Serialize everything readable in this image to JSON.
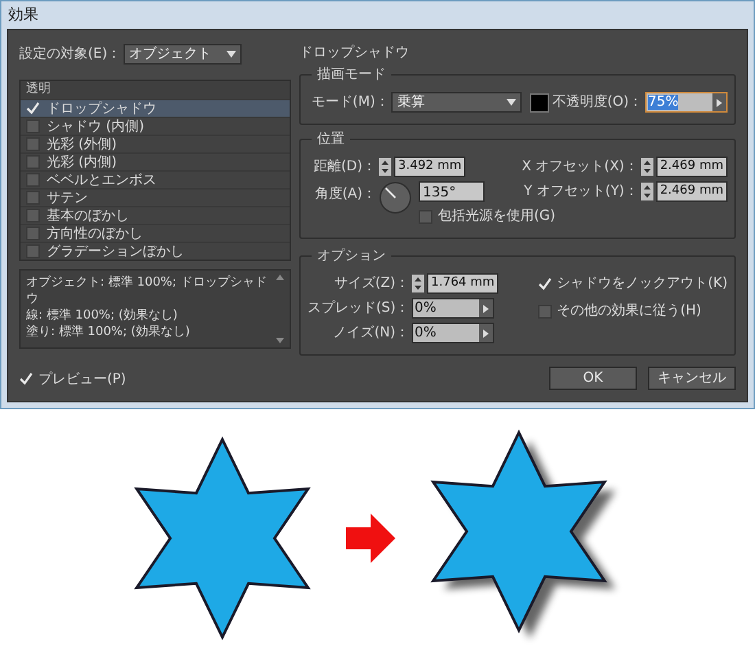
{
  "window": {
    "title": "効果"
  },
  "target": {
    "label": "設定の対象(E)：",
    "value": "オブジェクト"
  },
  "section_title": "ドロップシャドウ",
  "effects_list": {
    "header": "透明",
    "items": [
      {
        "label": "ドロップシャドウ",
        "checked": true,
        "selected": true
      },
      {
        "label": "シャドウ (内側)",
        "checked": false,
        "selected": false
      },
      {
        "label": "光彩 (外側)",
        "checked": false,
        "selected": false
      },
      {
        "label": "光彩 (内側)",
        "checked": false,
        "selected": false
      },
      {
        "label": "ベベルとエンボス",
        "checked": false,
        "selected": false
      },
      {
        "label": "サテン",
        "checked": false,
        "selected": false
      },
      {
        "label": "基本のぼかし",
        "checked": false,
        "selected": false
      },
      {
        "label": "方向性のぼかし",
        "checked": false,
        "selected": false
      },
      {
        "label": "グラデーションぼかし",
        "checked": false,
        "selected": false
      }
    ]
  },
  "summary": [
    "オブジェクト: 標準 100%; ドロップシャドウ",
    "線: 標準 100%; (効果なし)",
    "塗り: 標準 100%; (効果なし)"
  ],
  "preview": {
    "label": "プレビュー(P)",
    "checked": true
  },
  "blend_mode": {
    "title": "描画モード",
    "mode_label": "モード(M)：",
    "mode_value": "乗算",
    "opacity_label": "不透明度(O)：",
    "opacity_value": "75%"
  },
  "position": {
    "title": "位置",
    "distance_label": "距離(D)：",
    "distance": "3.492 mm",
    "angle_label": "角度(A)：",
    "angle": "135°",
    "global_light": {
      "label": "包括光源を使用(G)",
      "checked": false
    },
    "x_offset_label": "X オフセット(X)：",
    "x_offset": "2.469 mm",
    "y_offset_label": "Y オフセット(Y)：",
    "y_offset": "2.469 mm"
  },
  "options": {
    "title": "オプション",
    "size_label": "サイズ(Z)：",
    "size": "1.764 mm",
    "spread_label": "スプレッド(S)：",
    "spread": "0%",
    "noise_label": "ノイズ(N)：",
    "noise": "0%",
    "knockout": {
      "label": "シャドウをノックアウト(K)",
      "checked": true
    },
    "honor_others": {
      "label": "その他の効果に従う(H)",
      "checked": false
    }
  },
  "buttons": [
    {
      "label": "OK"
    },
    {
      "label": "キャンセル"
    }
  ]
}
